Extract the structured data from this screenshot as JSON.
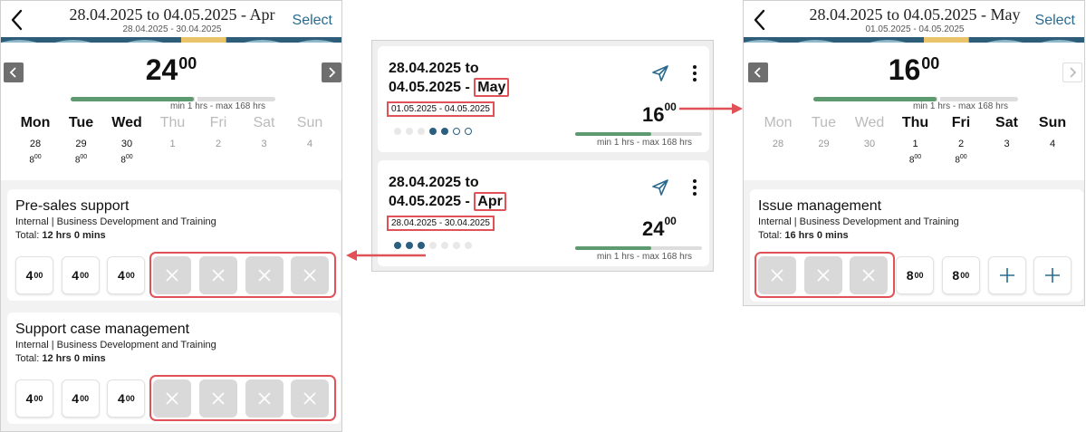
{
  "colors": {
    "accent": "#2b6a8f",
    "highlight": "#e05257",
    "progress": "#5e9a6f",
    "off_cell": "#d9d9d9"
  },
  "icons": {
    "back": "chevron-left-icon",
    "prev": "chevron-left-icon",
    "next": "chevron-right-icon",
    "send": "send-icon",
    "more": "more-vertical-icon",
    "empty": "close-icon",
    "add": "plus-icon"
  },
  "left": {
    "header": {
      "title": "28.04.2025 to 04.05.2025 - Apr",
      "subtitle": "28.04.2025 - 30.04.2025",
      "select": "Select"
    },
    "total": {
      "main": "24",
      "frac": "00"
    },
    "progress": 0.6,
    "limits": "min 1 hrs - max 168 hrs",
    "days": [
      {
        "name": "Mon",
        "date": "28",
        "h": "8",
        "m": "00"
      },
      {
        "name": "Tue",
        "date": "29",
        "h": "8",
        "m": "00"
      },
      {
        "name": "Wed",
        "date": "30",
        "h": "8",
        "m": "00"
      },
      {
        "name": "Thu",
        "date": "1"
      },
      {
        "name": "Fri",
        "date": "2"
      },
      {
        "name": "Sat",
        "date": "3"
      },
      {
        "name": "Sun",
        "date": "4"
      }
    ],
    "cards": [
      {
        "title": "Pre-sales support",
        "subtitle": "Internal | Business Development and Training",
        "total_label": "Total:",
        "total_value": "12 hrs 0 mins",
        "cells": [
          {
            "h": "4",
            "m": "00"
          },
          {
            "h": "4",
            "m": "00"
          },
          {
            "h": "4",
            "m": "00"
          }
        ]
      },
      {
        "title": "Support case management",
        "subtitle": "Internal | Business Development and Training",
        "total_label": "Total:",
        "total_value": "12 hrs 0 mins",
        "cells": [
          {
            "h": "4",
            "m": "00"
          },
          {
            "h": "4",
            "m": "00"
          },
          {
            "h": "4",
            "m": "00"
          }
        ]
      }
    ]
  },
  "middle": {
    "cards": [
      {
        "line1": "28.04.2025 to",
        "line2": "04.05.2025 - ",
        "month": "May",
        "range": "01.05.2025 - 04.05.2025",
        "total": "16",
        "frac": "00",
        "progress": 0.6,
        "limits": "min 1 hrs - max 168 hrs",
        "dots": [
          "e",
          "e",
          "e",
          "f",
          "f",
          "o",
          "o"
        ]
      },
      {
        "line1": "28.04.2025 to",
        "line2": "04.05.2025 - ",
        "month": "Apr",
        "range": "28.04.2025 - 30.04.2025",
        "total": "24",
        "frac": "00",
        "progress": 0.6,
        "limits": "min 1 hrs - max 168 hrs",
        "dots": [
          "f",
          "f",
          "f",
          "e",
          "e",
          "e",
          "e"
        ]
      }
    ]
  },
  "right": {
    "header": {
      "title": "28.04.2025 to 04.05.2025 - May",
      "subtitle": "01.05.2025 - 04.05.2025",
      "select": "Select"
    },
    "total": {
      "main": "16",
      "frac": "00"
    },
    "progress": 0.6,
    "limits": "min 1 hrs - max 168 hrs",
    "days": [
      {
        "name": "Mon",
        "date": "28"
      },
      {
        "name": "Tue",
        "date": "29"
      },
      {
        "name": "Wed",
        "date": "30"
      },
      {
        "name": "Thu",
        "date": "1",
        "h": "8",
        "m": "00"
      },
      {
        "name": "Fri",
        "date": "2",
        "h": "8",
        "m": "00"
      },
      {
        "name": "Sat",
        "date": "3"
      },
      {
        "name": "Sun",
        "date": "4"
      }
    ],
    "card": {
      "title": "Issue management",
      "subtitle": "Internal | Business Development and Training",
      "total_label": "Total:",
      "total_value": "16 hrs 0 mins",
      "cells": [
        {
          "h": "8",
          "m": "00"
        },
        {
          "h": "8",
          "m": "00"
        }
      ]
    }
  }
}
